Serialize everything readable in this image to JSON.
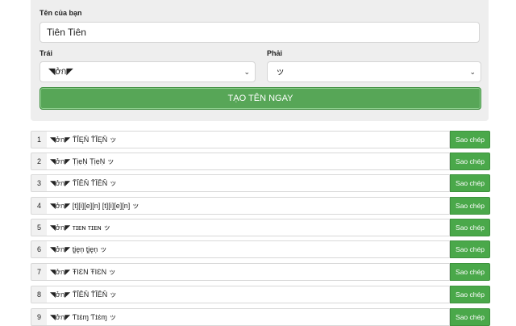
{
  "form": {
    "name_label": "Tên của bạn",
    "name_value": "Tiên Tiên",
    "left_label": "Trái",
    "left_value": "◥ởก◤",
    "right_label": "Phải",
    "right_value": "ッ",
    "generate_label": "TẠO TÊN NGAY"
  },
  "results": [
    {
      "index": "1",
      "name": "◥ởก◤ ŤĨĘŇ ŤĨĘŇ ッ",
      "copy_label": "Sao chép"
    },
    {
      "index": "2",
      "name": "◥ởก◤ ṬịẹṆ ṬịẹṆ ッ",
      "copy_label": "Sao chép"
    },
    {
      "index": "3",
      "name": "◥ởก◤ ŤĬĔŇ ŤĬĔŇ ッ",
      "copy_label": "Sao chép"
    },
    {
      "index": "4",
      "name": "◥ởก◤ [t][i][e][n] [t][i][e][n] ッ",
      "copy_label": "Sao chép"
    },
    {
      "index": "5",
      "name": "◥ởก◤ ᴛɪᴇɴ ᴛɪᴇɴ ッ",
      "copy_label": "Sao chép"
    },
    {
      "index": "6",
      "name": "◥ởก◤ ţįęņ ţįęņ ッ",
      "copy_label": "Sao chép"
    },
    {
      "index": "7",
      "name": "◥ởก◤ ŦIƐN ŦIƐN ッ",
      "copy_label": "Sao chép"
    },
    {
      "index": "8",
      "name": "◥ởก◤ ŤĨĔŇ ŤĨĔŇ ッ",
      "copy_label": "Sao chép"
    },
    {
      "index": "9",
      "name": "◥ởก◤ Ƭɪ̇ɛ̇ɱ Ƭɪ̇ɛ̇ɱ ッ",
      "copy_label": "Sao chép"
    }
  ],
  "icons": {
    "select_chevron": "chevron-down-icon"
  },
  "colors": {
    "accent_green": "#57a657",
    "copy_green": "#4aa84a",
    "panel_bg": "#eeeeee"
  }
}
